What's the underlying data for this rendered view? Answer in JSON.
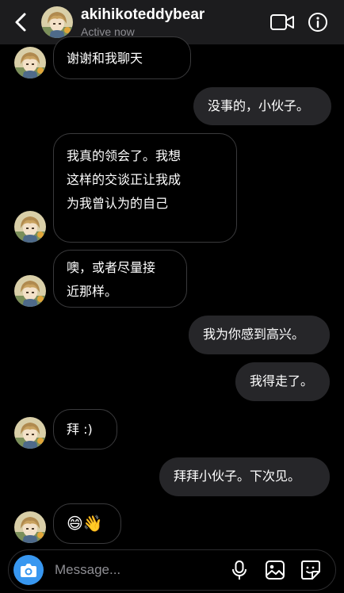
{
  "header": {
    "username": "akihikoteddybear",
    "status": "Active now"
  },
  "messages": [
    {
      "side": "in",
      "text": "谢谢和我聊天"
    },
    {
      "side": "out",
      "text": "没事的，小伙子。"
    },
    {
      "side": "in",
      "text": "我真的领会了。我想\n这样的交谈正让我成\n为我曾认为的自己"
    },
    {
      "side": "in",
      "text": "噢，或者尽量接\n近那样。"
    },
    {
      "side": "out",
      "text": "我为你感到高兴。"
    },
    {
      "side": "out",
      "text": "我得走了。"
    },
    {
      "side": "in",
      "text": "拜 :)"
    },
    {
      "side": "out",
      "text": "拜拜小伙子。下次见。"
    },
    {
      "side": "in",
      "text": "😄👋"
    }
  ],
  "composer": {
    "placeholder": "Message..."
  },
  "icons": [
    "back-arrow-icon",
    "video-call-icon",
    "info-icon",
    "camera-icon",
    "microphone-icon",
    "gallery-icon",
    "sticker-icon"
  ],
  "colors": {
    "background": "#000000",
    "header": "#1c1c1e",
    "outgoing_bubble": "#262629",
    "accent": "#3897f0",
    "secondary_text": "#8e8e93"
  }
}
